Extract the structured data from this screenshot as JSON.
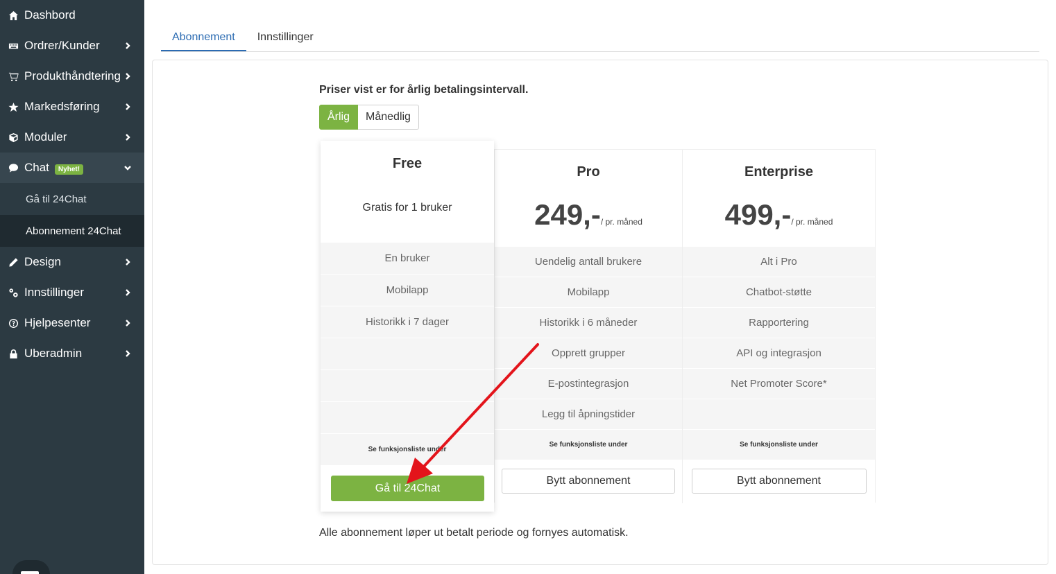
{
  "sidebar": {
    "items": [
      {
        "label": "Dashbord",
        "icon": "home-icon"
      },
      {
        "label": "Ordrer/Kunder",
        "icon": "keyboard-icon"
      },
      {
        "label": "Produkthåndtering",
        "icon": "cart-icon"
      },
      {
        "label": "Markedsføring",
        "icon": "star-icon"
      },
      {
        "label": "Moduler",
        "icon": "cube-icon"
      },
      {
        "label": "Chat",
        "icon": "chat-icon",
        "badge": "Nyhet!"
      },
      {
        "label": "Design",
        "icon": "pencil-icon"
      },
      {
        "label": "Innstillinger",
        "icon": "gears-icon"
      },
      {
        "label": "Hjelpesenter",
        "icon": "question-icon"
      },
      {
        "label": "Uberadmin",
        "icon": "lock-icon"
      }
    ],
    "chat_sub": [
      "Gå til 24Chat",
      "Abonnement 24Chat"
    ]
  },
  "tabs": [
    "Abonnement",
    "Innstillinger"
  ],
  "price_note": "Priser vist er for årlig betalingsintervall.",
  "interval": {
    "yearly": "Årlig",
    "monthly": "Månedlig"
  },
  "plans": {
    "free": {
      "name": "Free",
      "subtitle": "Gratis for 1 bruker",
      "features": [
        "En bruker",
        "Mobilapp",
        "Historikk i 7 dager"
      ],
      "note": "Se funksjonsliste under",
      "button": "Gå til 24Chat"
    },
    "pro": {
      "name": "Pro",
      "price": "249,-",
      "per": "/ pr. måned",
      "features": [
        "Uendelig antall brukere",
        "Mobilapp",
        "Historikk i 6 måneder",
        "Opprett grupper",
        "E-postintegrasjon",
        "Legg til åpningstider"
      ],
      "note": "Se funksjonsliste under",
      "button": "Bytt abonnement"
    },
    "enterprise": {
      "name": "Enterprise",
      "price": "499,-",
      "per": "/ pr. måned",
      "features": [
        "Alt i Pro",
        "Chatbot-støtte",
        "Rapportering",
        "API og integrasjon",
        "Net Promoter Score*"
      ],
      "note": "Se funksjonsliste under",
      "button": "Bytt abonnement"
    }
  },
  "footnote": "Alle abonnement løper ut betalt periode og fornyes automatisk.",
  "colors": {
    "accent_green": "#7cb342",
    "tab_blue": "#2b6bb2",
    "sidebar_bg": "#2c3a42",
    "arrow_red": "#e3141b"
  }
}
